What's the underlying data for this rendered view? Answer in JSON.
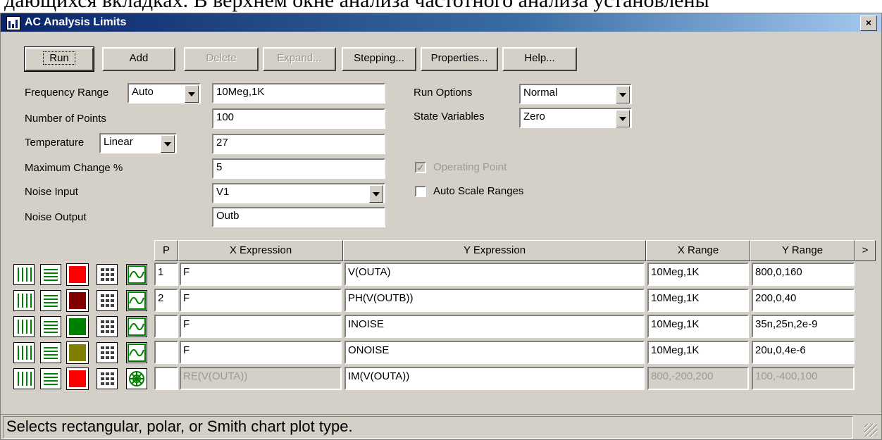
{
  "doc_strip_text": "дающихся вкладках. В верхнем окне анализа частотного анализа установлены",
  "window": {
    "title": "AC Analysis Limits",
    "close_label": "×"
  },
  "toolbar": {
    "run": "Run",
    "add": "Add",
    "delete": "Delete",
    "expand": "Expand...",
    "stepping": "Stepping...",
    "properties": "Properties...",
    "help": "Help..."
  },
  "form": {
    "frequency_range_label": "Frequency Range",
    "frequency_mode": "Auto",
    "frequency_value": "10Meg,1K",
    "points_label": "Number of Points",
    "points_value": "100",
    "temperature_label": "Temperature",
    "temperature_mode": "Linear",
    "temperature_value": "27",
    "max_change_label": "Maximum Change %",
    "max_change_value": "5",
    "noise_input_label": "Noise Input",
    "noise_input_value": "V1",
    "noise_output_label": "Noise Output",
    "noise_output_value": "Outb",
    "run_options_label": "Run Options",
    "run_options_value": "Normal",
    "state_variables_label": "State Variables",
    "state_variables_value": "Zero",
    "operating_point_label": "Operating Point",
    "operating_point_checked": true,
    "auto_scale_label": "Auto Scale Ranges",
    "auto_scale_checked": false
  },
  "table": {
    "headers": {
      "p": "P",
      "x_expr": "X Expression",
      "y_expr": "Y Expression",
      "x_range": "X Range",
      "y_range": "Y Range",
      "scroll": ">"
    },
    "rows": [
      {
        "p": "1",
        "x": "F",
        "y": "V(OUTA)",
        "x_range": "10Meg,1K",
        "y_range": "800,0,160",
        "color": "#ff0000",
        "plot_icon": "wave-icon",
        "disabled": false
      },
      {
        "p": "2",
        "x": "F",
        "y": "PH(V(OUTB))",
        "x_range": "10Meg,1K",
        "y_range": "200,0,40",
        "color": "#800000",
        "plot_icon": "wave-icon",
        "disabled": false
      },
      {
        "p": "",
        "x": "F",
        "y": "INOISE",
        "x_range": "10Meg,1K",
        "y_range": "35n,25n,2e-9",
        "color": "#008000",
        "plot_icon": "wave-icon",
        "disabled": false
      },
      {
        "p": "",
        "x": "F",
        "y": "ONOISE",
        "x_range": "10Meg,1K",
        "y_range": "20u,0,4e-6",
        "color": "#808000",
        "plot_icon": "wave-icon",
        "disabled": false
      },
      {
        "p": "",
        "x": "RE(V(OUTA))",
        "y": "IM(V(OUTA))",
        "x_range": "800,-200,200",
        "y_range": "100,-400,100",
        "color": "#ff0000",
        "plot_icon": "polar-icon",
        "disabled": true
      }
    ]
  },
  "status_text": "Selects rectangular, polar, or Smith chart plot type."
}
